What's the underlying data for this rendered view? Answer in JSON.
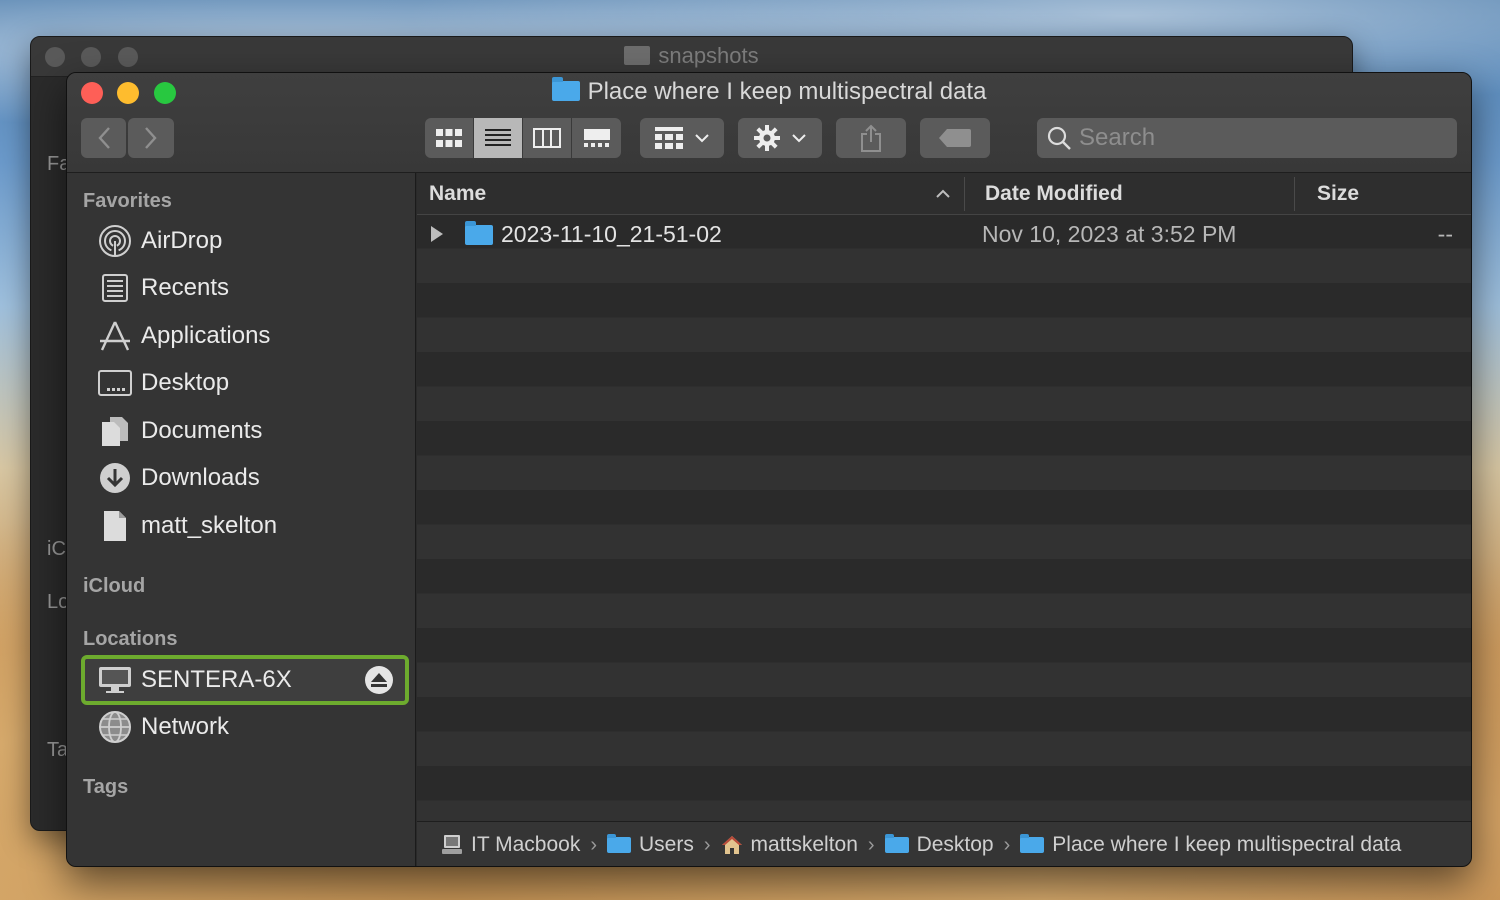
{
  "back_window": {
    "title": "snapshots",
    "side_labels": [
      "Fa",
      "iC",
      "Lo",
      "Ta"
    ]
  },
  "window": {
    "title": "Place where I keep multispectral data"
  },
  "toolbar": {
    "back_icon": "chevron-left-icon",
    "forward_icon": "chevron-right-icon",
    "view_modes": [
      "icon-view",
      "list-view",
      "column-view",
      "gallery-view"
    ],
    "active_view": "list-view",
    "search_placeholder": "Search"
  },
  "sidebar": {
    "favorites_header": "Favorites",
    "favorites": [
      {
        "label": "AirDrop",
        "icon": "airdrop-icon"
      },
      {
        "label": "Recents",
        "icon": "recents-icon"
      },
      {
        "label": "Applications",
        "icon": "applications-icon"
      },
      {
        "label": "Desktop",
        "icon": "desktop-icon"
      },
      {
        "label": "Documents",
        "icon": "documents-icon"
      },
      {
        "label": "Downloads",
        "icon": "downloads-icon"
      },
      {
        "label": "matt_skelton",
        "icon": "file-icon"
      }
    ],
    "icloud_header": "iCloud",
    "locations_header": "Locations",
    "locations": [
      {
        "label": "SENTERA-6X",
        "icon": "drive-icon",
        "selected": true
      },
      {
        "label": "Network",
        "icon": "network-icon"
      }
    ],
    "tags_header": "Tags"
  },
  "list": {
    "columns": {
      "name": "Name",
      "date": "Date Modified",
      "size": "Size"
    },
    "rows": [
      {
        "name": "2023-11-10_21-51-02",
        "date": "Nov 10, 2023 at 3:52 PM",
        "size": "--"
      }
    ]
  },
  "path_bar": [
    {
      "label": "IT Macbook",
      "icon": "computer-icon"
    },
    {
      "label": "Users",
      "icon": "folder-icon"
    },
    {
      "label": "mattskelton",
      "icon": "home-icon"
    },
    {
      "label": "Desktop",
      "icon": "folder-icon"
    },
    {
      "label": "Place where I keep multispectral data",
      "icon": "folder-icon"
    }
  ],
  "colors": {
    "selection_outline": "#6dab2e",
    "folder_blue": "#4aa9ea"
  }
}
